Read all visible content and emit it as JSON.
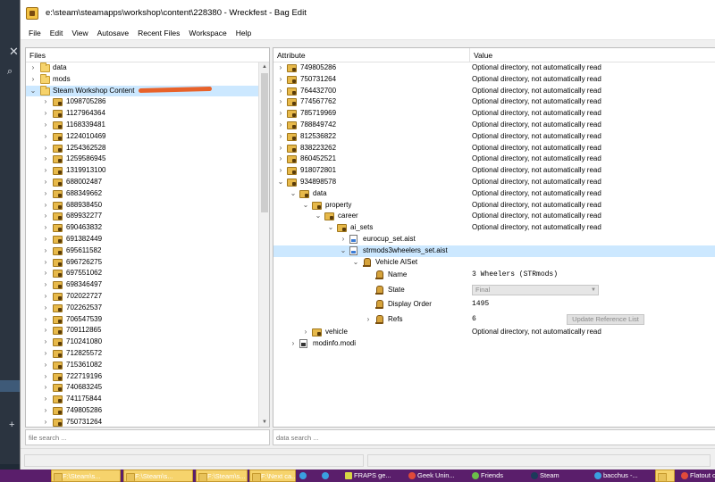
{
  "window": {
    "title": "e:\\steam\\steamapps\\workshop\\content\\228380 - Wreckfest - Bag Edit"
  },
  "menu": [
    "File",
    "Edit",
    "View",
    "Autosave",
    "Recent Files",
    "Workspace",
    "Help"
  ],
  "files_pane": {
    "header": "Files",
    "search_placeholder": "file search ...",
    "top_items": [
      {
        "label": "data",
        "arrow": ">",
        "icon": "folder-icon"
      },
      {
        "label": "mods",
        "arrow": ">",
        "icon": "folder-icon"
      },
      {
        "label": "Steam Workshop Content",
        "arrow": "v",
        "icon": "folder-icon",
        "selected": true
      }
    ],
    "workshop_items": [
      "1098705286",
      "1127964364",
      "1168339481",
      "1224010469",
      "1254362528",
      "1259586945",
      "1319913100",
      "688002487",
      "688349662",
      "688938450",
      "689932277",
      "690463832",
      "691382449",
      "695611582",
      "696726275",
      "697551062",
      "698346497",
      "702022727",
      "702262537",
      "706547539",
      "709112865",
      "710241080",
      "712825572",
      "715361082",
      "722719196",
      "740683245",
      "741175844",
      "749805286",
      "750731264"
    ]
  },
  "attr_pane": {
    "columns": {
      "attribute": "Attribute",
      "value": "Value"
    },
    "search_placeholder": "data search ...",
    "optional_text": "Optional directory, not automatically read",
    "dir_rows": [
      "749805286",
      "750731264",
      "764432700",
      "774567762",
      "785719969",
      "788849742",
      "812536822",
      "838223262",
      "860452521",
      "918072801"
    ],
    "expanded_dir": "934898578",
    "tree": {
      "data": "data",
      "property": "property",
      "career": "career",
      "ai_sets": "ai_sets",
      "eurocup": "eurocup_set.aist",
      "strmods": "strmods3wheelers_set.aist",
      "vehicle_aiset": "Vehicle AISet",
      "vehicle": "vehicle",
      "modinfo": "modinfo.modi"
    },
    "properties": {
      "name_label": "Name",
      "name_value": "3 Wheelers (STRmods)",
      "state_label": "State",
      "state_value": "Final",
      "order_label": "Display Order",
      "order_value": "1495",
      "refs_label": "Refs",
      "refs_value": "6",
      "update_button": "Update Reference List"
    }
  },
  "taskbar": [
    {
      "label": "F:\\Steam\\s...",
      "kind": "folder"
    },
    {
      "label": "F:\\Steam\\s...",
      "kind": "folder"
    },
    {
      "label": "F:\\Steam\\s...",
      "kind": "folder"
    },
    {
      "label": "F:\\Next ca...",
      "kind": "folder"
    },
    {
      "label": "",
      "kind": "web"
    },
    {
      "label": "",
      "kind": "web"
    },
    {
      "label": "FRAPS ge...",
      "kind": "fraps"
    },
    {
      "label": "Geek Unin...",
      "kind": "chrome"
    },
    {
      "label": "Friends",
      "kind": "friends"
    },
    {
      "label": "Steam",
      "kind": "steam"
    },
    {
      "label": "bacchus -...",
      "kind": "web"
    },
    {
      "label": "",
      "kind": "folder"
    },
    {
      "label": "Flatout ori...",
      "kind": "chrome"
    }
  ]
}
